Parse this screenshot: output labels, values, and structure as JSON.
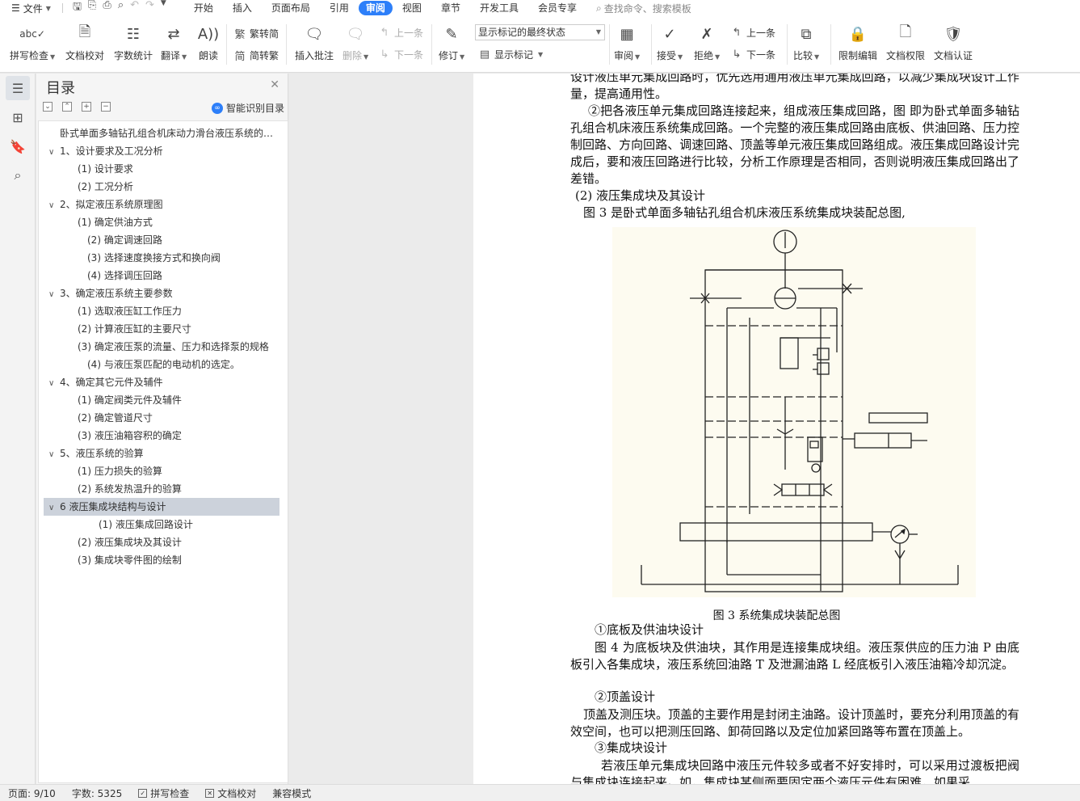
{
  "menubar": {
    "file_label": "文件",
    "tabs": [
      "开始",
      "插入",
      "页面布局",
      "引用",
      "审阅",
      "视图",
      "章节",
      "开发工具",
      "会员专享"
    ],
    "active_tab": "审阅",
    "search_placeholder": "查找命令、搜索模板"
  },
  "ribbon": {
    "spellcheck": "拼写检查",
    "proofread": "文档校对",
    "wordcount": "字数统计",
    "translate": "翻译",
    "read_aloud": "朗读",
    "to_traditional": "繁转简",
    "to_simplified": "简转繁",
    "insert_comment": "插入批注",
    "delete": "删除",
    "prev_comment": "上一条",
    "next_comment": "下一条",
    "track_changes": "修订",
    "markup_select": "显示标记的最终状态",
    "show_markup": "显示标记",
    "review": "审阅",
    "accept": "接受",
    "reject": "拒绝",
    "prev_change": "上一条",
    "next_change": "下一条",
    "compare": "比较",
    "restrict_edit": "限制编辑",
    "doc_permission": "文档权限",
    "doc_certify": "文档认证"
  },
  "toc": {
    "title": "目录",
    "smart_label": "智能识别目录",
    "items": [
      {
        "label": "卧式单面多轴钻孔组合机床动力滑台液压系统的设计",
        "level": 0
      },
      {
        "label": "1、设计要求及工况分析",
        "level": 1
      },
      {
        "label": "(1) 设计要求",
        "level": 2
      },
      {
        "label": "(2) 工况分析",
        "level": 2
      },
      {
        "label": "2、拟定液压系统原理图",
        "level": 1
      },
      {
        "label": "(1) 确定供油方式",
        "level": 2
      },
      {
        "label": "(2) 确定调速回路",
        "level": 3
      },
      {
        "label": "(3) 选择速度换接方式和换向阀",
        "level": 3
      },
      {
        "label": "(4) 选择调压回路",
        "level": 3
      },
      {
        "label": "3、确定液压系统主要参数",
        "level": 1
      },
      {
        "label": "(1) 选取液压缸工作压力",
        "level": 2
      },
      {
        "label": "(2) 计算液压缸的主要尺寸",
        "level": 2
      },
      {
        "label": "(3) 确定液压泵的流量、压力和选择泵的规格",
        "level": 2
      },
      {
        "label": "(4) 与液压泵匹配的电动机的选定。",
        "level": 3
      },
      {
        "label": "4、确定其它元件及辅件",
        "level": 1
      },
      {
        "label": "(1) 确定阀类元件及辅件",
        "level": 2
      },
      {
        "label": "(2) 确定管道尺寸",
        "level": 2
      },
      {
        "label": "(3) 液压油箱容积的确定",
        "level": 2
      },
      {
        "label": "5、液压系统的验算",
        "level": 1
      },
      {
        "label": "(1) 压力损失的验算",
        "level": 2
      },
      {
        "label": "(2) 系统发热温升的验算",
        "level": 2
      },
      {
        "label": "6 液压集成块结构与设计",
        "level": 1
      },
      {
        "label": "(1) 液压集成回路设计",
        "level": 4
      },
      {
        "label": "(2) 液压集成块及其设计",
        "level": 2
      },
      {
        "label": "(3) 集成块零件图的绘制",
        "level": 2
      }
    ]
  },
  "document": {
    "p1": "设计液压单元集成回路时，优先选用通用液压单元集成回路，以减少集成块设计工作量，提高通用性。",
    "p2": "②把各液压单元集成回路连接起来，组成液压集成回路，图  即为卧式单面多轴钻孔组合机床液压系统集成回路。一个完整的液压集成回路由底板、供油回路、压力控制回路、方向回路、调速回路、顶盖等单元液压集成回路组成。液压集成回路设计完成后，要和液压回路进行比较，分析工作原理是否相同，否则说明液压集成回路出了差错。",
    "p3": "(2) 液压集成块及其设计",
    "p4": "图 3 是卧式单面多轴钻孔组合机床液压系统集成块装配总图,",
    "caption": "图 3  系统集成块装配总图",
    "p5": "①底板及供油块设计",
    "p6": "图 4 为底板块及供油块，其作用是连接集成块组。液压泵供应的压力油 P 由底板引入各集成块，液压系统回油路 T 及泄漏油路 L 经底板引入液压油箱冷却沉淀。",
    "p7": "②顶盖设计",
    "p8": "顶盖及测压块。顶盖的主要作用是封闭主油路。设计顶盖时，要充分利用顶盖的有效空间，也可以把测压回路、卸荷回路以及定位加紧回路等布置在顶盖上。",
    "p9": "③集成块设计",
    "p10": "若液压单元集成块回路中液压元件较多或者不好安排时，可以采用过渡板把阀与集成块连接起来。如，集成块某侧面要固定两个液压元件有困难，如果采"
  },
  "status": {
    "page": "页面: 9/10",
    "words": "字数: 5325",
    "spellcheck": "拼写检查",
    "proofread": "文档校对",
    "compat": "兼容模式"
  },
  "colors": {
    "accent": "#2d7ff9",
    "selected_toc": "#ccd2db",
    "figure_bg": "#fdfbf0"
  }
}
